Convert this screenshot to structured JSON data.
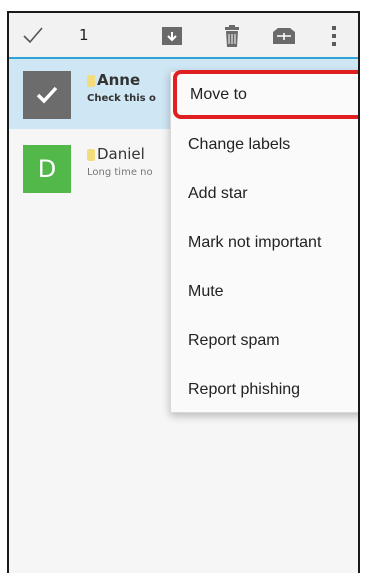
{
  "actionbar": {
    "selected_count": "1",
    "icons": [
      "check-icon",
      "archive-icon",
      "trash-icon",
      "label-icon",
      "more-vert-icon"
    ],
    "accent_color": "#2fa3d4"
  },
  "emails": [
    {
      "sender": "Anne",
      "snippet": "Check this o",
      "avatar": "checkmark",
      "selected": true
    },
    {
      "sender": "Daniel",
      "snippet": "Long time no",
      "avatar": "D",
      "selected": false
    }
  ],
  "menu": {
    "items": [
      "Move to",
      "Change labels",
      "Add star",
      "Mark not important",
      "Mute",
      "Report spam",
      "Report phishing"
    ],
    "highlighted_item": "Move to",
    "highlight_color": "#e02020"
  }
}
